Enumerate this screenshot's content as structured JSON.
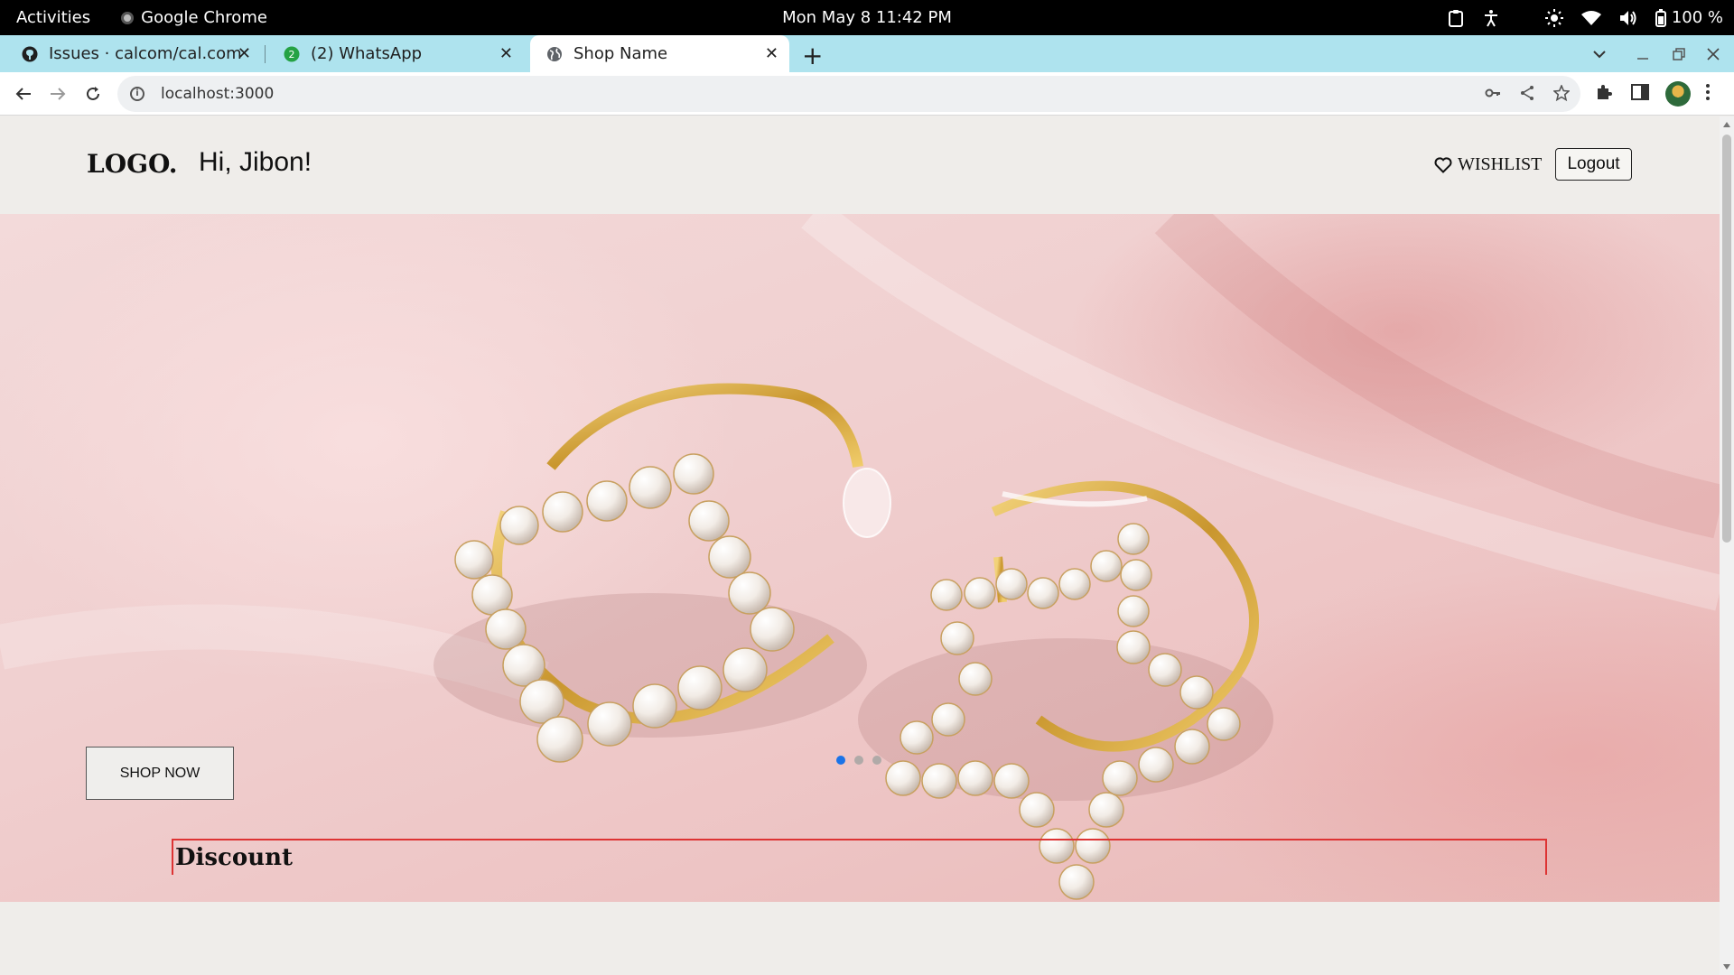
{
  "system_bar": {
    "activities": "Activities",
    "app_name": "Google Chrome",
    "datetime": "Mon May 8  11:42 PM",
    "battery": "100 %"
  },
  "browser": {
    "tabs": [
      {
        "title": "Issues · calcom/cal.com · G",
        "icon": "github-icon"
      },
      {
        "title": "(2) WhatsApp",
        "icon": "whatsapp-icon",
        "badge": "2"
      },
      {
        "title": "Shop Name",
        "icon": "globe-icon",
        "active": true
      }
    ],
    "url": "localhost:3000"
  },
  "site": {
    "logo": "LOGO.",
    "greeting": "Hi, Jibon!",
    "wishlist_label": "WISHLIST",
    "logout_label": "Logout",
    "hero": {
      "cta_label": "SHOP NOW",
      "slides": 3,
      "active_slide": 1
    },
    "discount_heading": "Discount"
  },
  "colors": {
    "topbar_bg": "#000000",
    "tabstrip_bg": "#aee3ee",
    "page_bg": "#efedea",
    "carousel_active_dot": "#1a73e8",
    "discount_border": "#dd3333"
  }
}
